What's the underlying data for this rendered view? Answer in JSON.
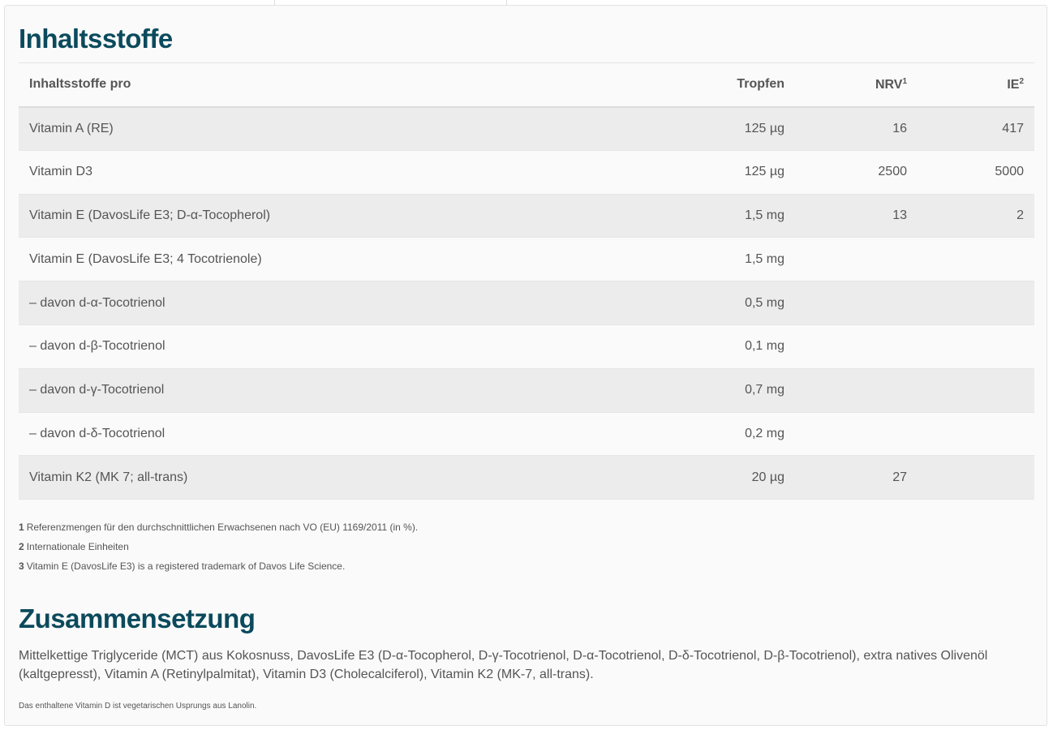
{
  "ingredients": {
    "title": "Inhaltsstoffe",
    "headers": {
      "name": "Inhaltsstoffe pro",
      "drops": "Tropfen",
      "nrv": "NRV",
      "nrv_sup": "1",
      "ie": "IE",
      "ie_sup": "2"
    },
    "rows": [
      {
        "name": "Vitamin A (RE)",
        "drops": "125 µg",
        "nrv": "16",
        "ie": "417"
      },
      {
        "name": "Vitamin D3",
        "drops": "125 µg",
        "nrv": "2500",
        "ie": "5000"
      },
      {
        "name": "Vitamin E (DavosLife E3; D-α-Tocopherol)",
        "drops": "1,5 mg",
        "nrv": "13",
        "ie": "2"
      },
      {
        "name": "Vitamin E (DavosLife E3; 4 Tocotrienole)",
        "drops": "1,5 mg",
        "nrv": "",
        "ie": ""
      },
      {
        "name": "– davon d-α-Tocotrienol",
        "drops": "0,5 mg",
        "nrv": "",
        "ie": ""
      },
      {
        "name": "– davon d-β-Tocotrienol",
        "drops": "0,1 mg",
        "nrv": "",
        "ie": ""
      },
      {
        "name": "– davon d-γ-Tocotrienol",
        "drops": "0,7 mg",
        "nrv": "",
        "ie": ""
      },
      {
        "name": "– davon d-δ-Tocotrienol",
        "drops": "0,2 mg",
        "nrv": "",
        "ie": ""
      },
      {
        "name": "Vitamin K2 (MK 7; all-trans)",
        "drops": "20 µg",
        "nrv": "27",
        "ie": ""
      }
    ],
    "footnotes": [
      {
        "num": "1",
        "text": "Referenzmengen für den durchschnittlichen Erwachsenen nach VO (EU) 1169/2011 (in %)."
      },
      {
        "num": "2",
        "text": "Internationale Einheiten"
      },
      {
        "num": "3",
        "text": "Vitamin E (DavosLife E3) is a registered trademark of Davos Life Science."
      }
    ]
  },
  "composition": {
    "title": "Zusammensetzung",
    "text": "Mittelkettige Triglyceride (MCT) aus Kokosnuss, DavosLife E3 (D-α-Tocopherol, D-γ-Tocotrienol, D-α-Tocotrienol, D-δ-Tocotrienol, D-β-Tocotrienol), extra natives Olivenöl (kaltgepresst), Vitamin A (Retinylpalmitat), Vitamin D3 (Cholecalciferol), Vitamin K2 (MK-7, all-trans).",
    "note": "Das enthaltene Vitamin D ist vegetarischen Usprungs aus Lanolin."
  }
}
